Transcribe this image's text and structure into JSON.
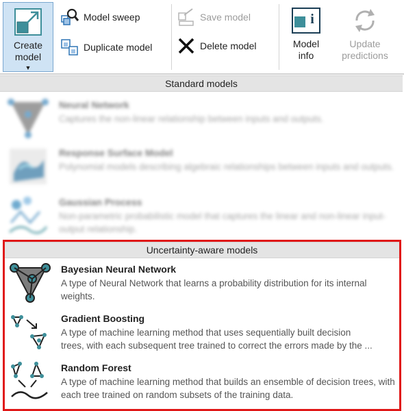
{
  "ribbon": {
    "create_model_label": "Create model",
    "model_sweep_label": "Model sweep",
    "duplicate_model_label": "Duplicate model",
    "save_model_label": "Save model",
    "delete_model_label": "Delete model",
    "model_info_label": "Model info",
    "update_predictions_label": "Update predictions"
  },
  "dropdown": {
    "standard_header": "Standard models",
    "standard_models": [
      {
        "title": "Neural Network",
        "description": "Captures the non-linear relationship between inputs and outputs."
      },
      {
        "title": "Response Surface Model",
        "description": "Polynomial models describing algebraic relationships between inputs and outputs."
      },
      {
        "title": "Gaussian Process",
        "description": "Non-parametric probabilistic model that captures the linear and non-linear input-output relationship."
      }
    ],
    "uncertainty_header": "Uncertainty-aware models",
    "uncertainty_models": [
      {
        "title": "Bayesian Neural Network",
        "description": "A type of Neural Network that learns a probability distribution for its internal weights."
      },
      {
        "title": "Gradient Boosting",
        "description_line1": "A type of machine learning method that uses sequentially built decision",
        "description_line2": "trees, with each subsequent tree trained to correct the errors made by the ..."
      },
      {
        "title": "Random Forest",
        "description": "A type of machine learning method that builds an ensemble of decision trees, with each tree trained on random subsets of the training data."
      }
    ]
  },
  "colors": {
    "accent_blue": "#2e75b6",
    "teal": "#3e8f9a",
    "highlight_red": "#e01818",
    "selected_button_bg": "#cfe3f4"
  }
}
